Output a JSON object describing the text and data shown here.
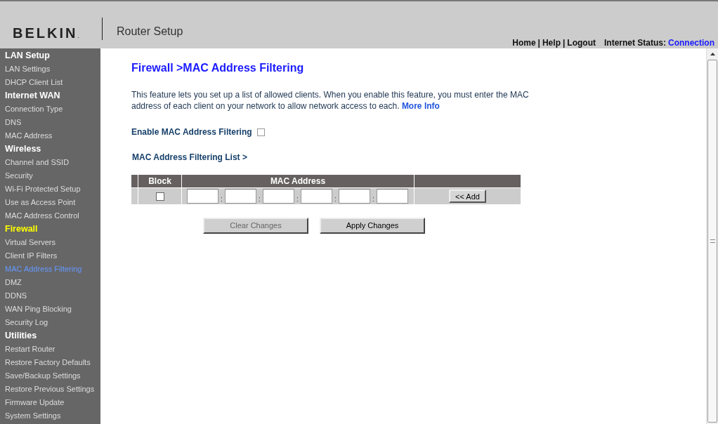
{
  "header": {
    "brand": "BELKIN",
    "brand_mark": ".",
    "product": "Router Setup",
    "links": [
      "Home",
      "Help",
      "Logout"
    ],
    "link_separators": [
      "|",
      "|"
    ],
    "status_label": "Internet Status:",
    "status_value": "Connection"
  },
  "sidebar": {
    "items": [
      {
        "kind": "heading",
        "label": "LAN Setup",
        "selected": false
      },
      {
        "kind": "item",
        "label": "LAN Settings",
        "selected": false
      },
      {
        "kind": "item",
        "label": "DHCP Client List",
        "selected": false
      },
      {
        "kind": "heading",
        "label": "Internet WAN",
        "selected": false
      },
      {
        "kind": "item",
        "label": "Connection Type",
        "selected": false
      },
      {
        "kind": "item",
        "label": "DNS",
        "selected": false
      },
      {
        "kind": "item",
        "label": "MAC Address",
        "selected": false
      },
      {
        "kind": "heading",
        "label": "Wireless",
        "selected": false
      },
      {
        "kind": "item",
        "label": "Channel and SSID",
        "selected": false
      },
      {
        "kind": "item",
        "label": "Security",
        "selected": false
      },
      {
        "kind": "item",
        "label": "Wi-Fi Protected Setup",
        "selected": false
      },
      {
        "kind": "item",
        "label": "Use as Access Point",
        "selected": false
      },
      {
        "kind": "item",
        "label": "MAC Address Control",
        "selected": false
      },
      {
        "kind": "heading",
        "label": "Firewall",
        "selected": true
      },
      {
        "kind": "item",
        "label": "Virtual Servers",
        "selected": false
      },
      {
        "kind": "item",
        "label": "Client IP Filters",
        "selected": false
      },
      {
        "kind": "item",
        "label": "MAC Address Filtering",
        "selected": true
      },
      {
        "kind": "item",
        "label": "DMZ",
        "selected": false
      },
      {
        "kind": "item",
        "label": "DDNS",
        "selected": false
      },
      {
        "kind": "item",
        "label": "WAN Ping Blocking",
        "selected": false
      },
      {
        "kind": "item",
        "label": "Security Log",
        "selected": false
      },
      {
        "kind": "heading",
        "label": "Utilities",
        "selected": false
      },
      {
        "kind": "item",
        "label": "Restart Router",
        "selected": false
      },
      {
        "kind": "item",
        "label": "Restore Factory Defaults",
        "selected": false
      },
      {
        "kind": "item",
        "label": "Save/Backup Settings",
        "selected": false
      },
      {
        "kind": "item",
        "label": "Restore Previous Settings",
        "selected": false
      },
      {
        "kind": "item",
        "label": "Firmware Update",
        "selected": false
      },
      {
        "kind": "item",
        "label": "System Settings",
        "selected": false
      }
    ]
  },
  "content": {
    "title": "Firewall >MAC Address Filtering",
    "description": "This feature lets you set up a list of allowed clients. When you enable this feature, you must enter the MAC address of each client on your network to allow network access to each.",
    "more_info": "More Info",
    "enable_label": "Enable MAC Address Filtering",
    "enable_checked": false,
    "list_heading": "MAC Address Filtering List >",
    "table": {
      "columns": [
        "Block",
        "MAC Address"
      ],
      "row": {
        "block_checked": false,
        "separators": [
          ":",
          ":",
          ":",
          ":",
          ":"
        ]
      },
      "add_button": "<< Add"
    },
    "buttons": [
      {
        "label": "Clear Changes",
        "disabled": true
      },
      {
        "label": "Apply Changes",
        "disabled": false
      }
    ]
  }
}
